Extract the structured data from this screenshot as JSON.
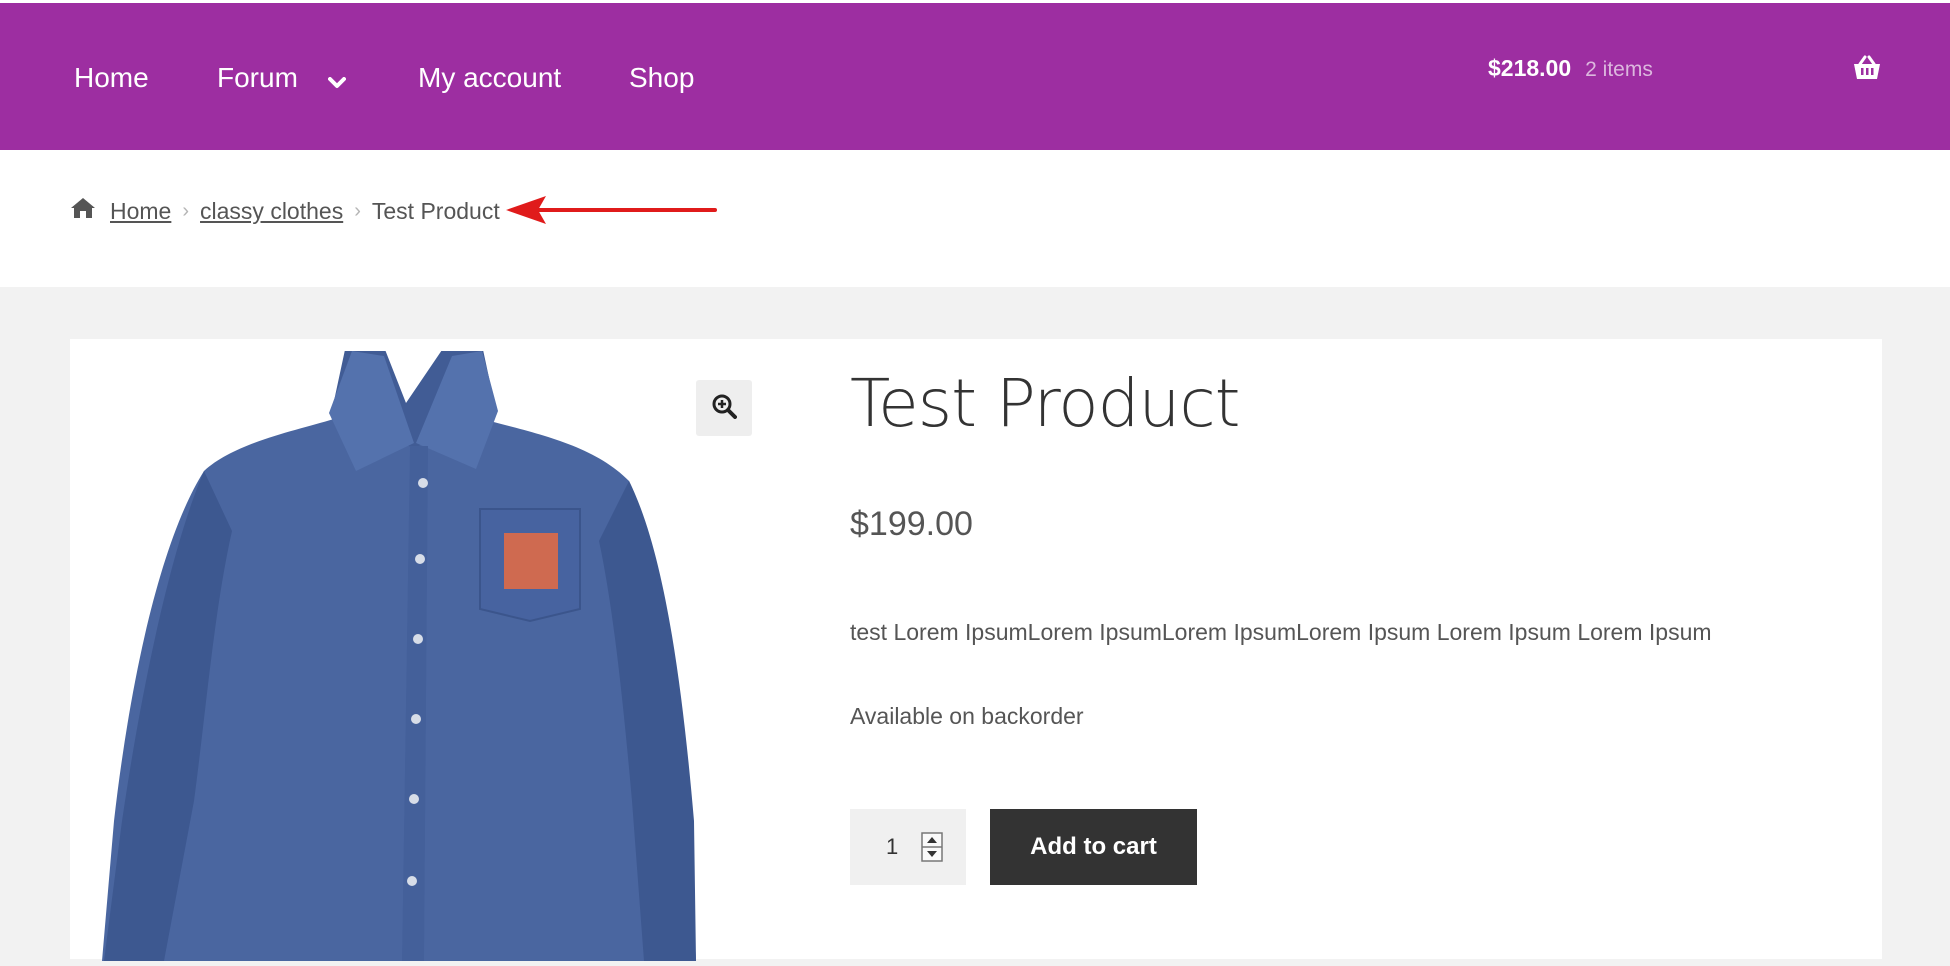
{
  "nav": {
    "home": "Home",
    "forum": "Forum",
    "my_account": "My account",
    "shop": "Shop"
  },
  "cart": {
    "total": "$218.00",
    "count": "2 items"
  },
  "breadcrumb": {
    "items": [
      "Home",
      "classy clothes"
    ],
    "current": "Test Product"
  },
  "product": {
    "title": "Test Product",
    "price": "$199.00",
    "description": "test Lorem IpsumLorem IpsumLorem IpsumLorem Ipsum Lorem Ipsum Lorem Ipsum",
    "availability": "Available on backorder",
    "quantity": "1",
    "add_to_cart_label": "Add to cart"
  },
  "colors": {
    "header_bg": "#9d2ea1",
    "button_bg": "#333333",
    "annotation_arrow": "#e01b1b",
    "shirt": "#4a66a0",
    "patch": "#cf6a50"
  },
  "icons": [
    "chevron-down-icon",
    "basket-icon",
    "home-icon",
    "zoom-icon",
    "red-arrow-annotation",
    "qty-stepper-icon"
  ]
}
